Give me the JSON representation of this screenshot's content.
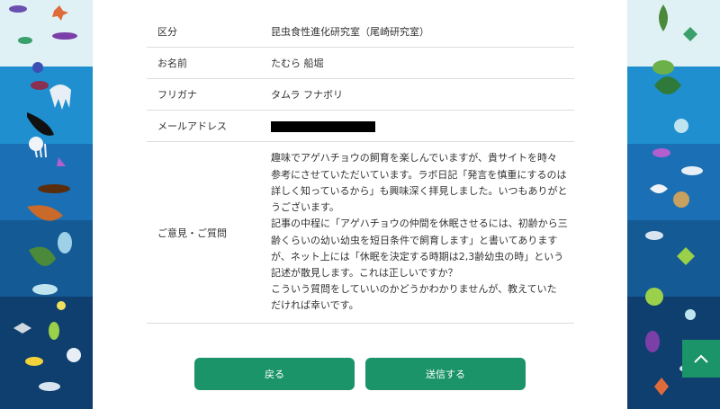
{
  "form": {
    "rows": [
      {
        "label": "区分",
        "value": "昆虫食性進化研究室（尾崎研究室）"
      },
      {
        "label": "お名前",
        "value": "たむら 船堀"
      },
      {
        "label": "フリガナ",
        "value": "タムラ フナボリ"
      },
      {
        "label": "メールアドレス",
        "value": ""
      },
      {
        "label": "ご意見・ご質問",
        "lines": [
          "趣味でアゲハチョウの飼育を楽しんでいますが、貴サイトを時々",
          "参考にさせていただいています。ラボ日記「発言を慎重にするのは",
          "詳しく知っているから」も興味深く拝見しました。いつもありがと",
          "うございます。",
          "記事の中程に「アゲハチョウの仲間を休眠させるには、初齢から三",
          "齢くらいの幼い幼虫を短日条件で飼育します」と書いてあります",
          "が、ネット上には「休眠を決定する時期は2,3齢幼虫の時」という",
          "記述が散見します。これは正しいですか？",
          "こういう質問をしていいのかどうかわかりませんが、教えていた",
          "だければ幸いです。"
        ]
      }
    ]
  },
  "buttons": {
    "back": "戻る",
    "submit": "送信する"
  },
  "pagetop": {
    "icon": "chevron-up-icon"
  },
  "colors": {
    "accent": "#1a9468"
  }
}
